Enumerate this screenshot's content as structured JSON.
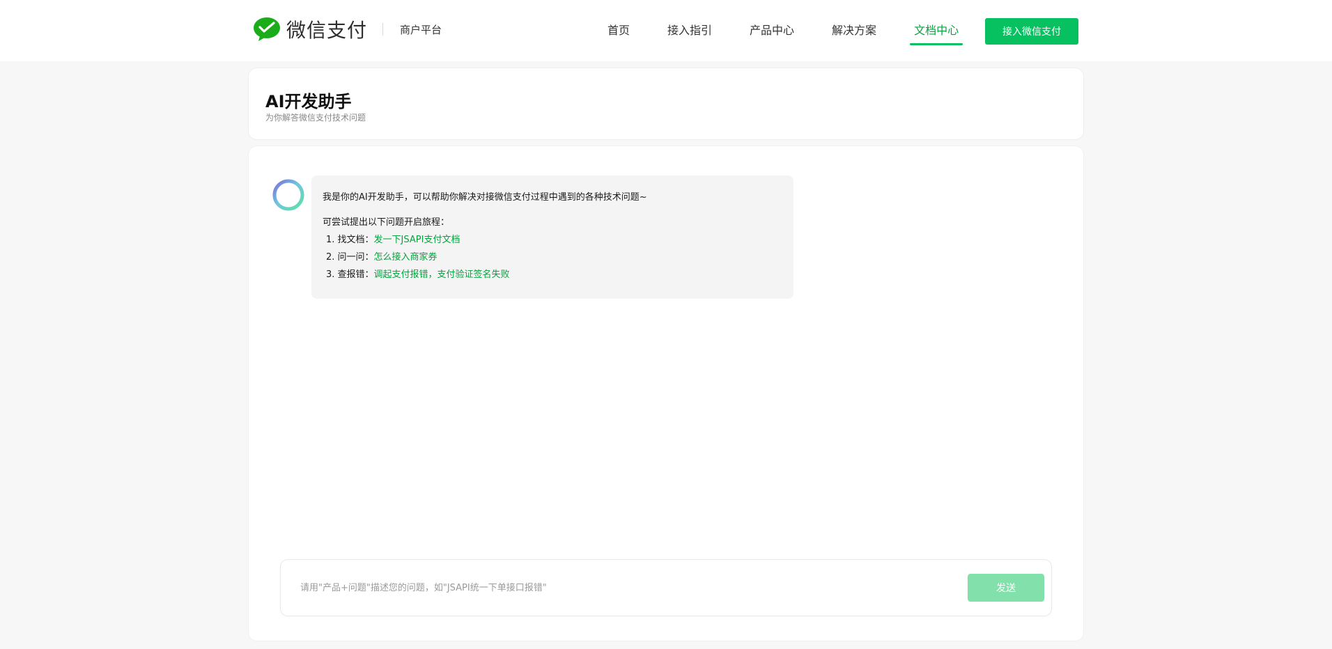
{
  "header": {
    "brand_name": "微信支付",
    "brand_sub": "商户平台",
    "nav": [
      {
        "label": "首页",
        "active": false
      },
      {
        "label": "接入指引",
        "active": false
      },
      {
        "label": "产品中心",
        "active": false
      },
      {
        "label": "解决方案",
        "active": false
      },
      {
        "label": "文档中心",
        "active": true
      }
    ],
    "cta_label": "接入微信支付"
  },
  "page": {
    "title": "AI开发助手",
    "subtitle": "为你解答微信支付技术问题"
  },
  "chat": {
    "intro": "我是你的AI开发助手，可以帮助你解决对接微信支付过程中遇到的各种技术问题~",
    "try_label": "可尝试提出以下问题开启旅程：",
    "suggestions": [
      {
        "prefix": "1. 找文档：",
        "link": "发一下JSAPI支付文档"
      },
      {
        "prefix": "2. 问一问：",
        "link": "怎么接入商家券"
      },
      {
        "prefix": "3. 查报错：",
        "link": "调起支付报错，支付验证签名失败"
      }
    ]
  },
  "input": {
    "value": "",
    "placeholder": "请用\"产品+问题\"描述您的问题，如\"JSAPI统一下单接口报错\"",
    "send_label": "发送"
  },
  "colors": {
    "brand_green": "#07c160",
    "link_green": "#07a13f",
    "send_disabled": "#82e0aa",
    "page_bg": "#f7f7f7"
  },
  "icons": {
    "logo": "wechat-pay-logo-icon",
    "avatar": "ai-assistant-ring-icon"
  }
}
